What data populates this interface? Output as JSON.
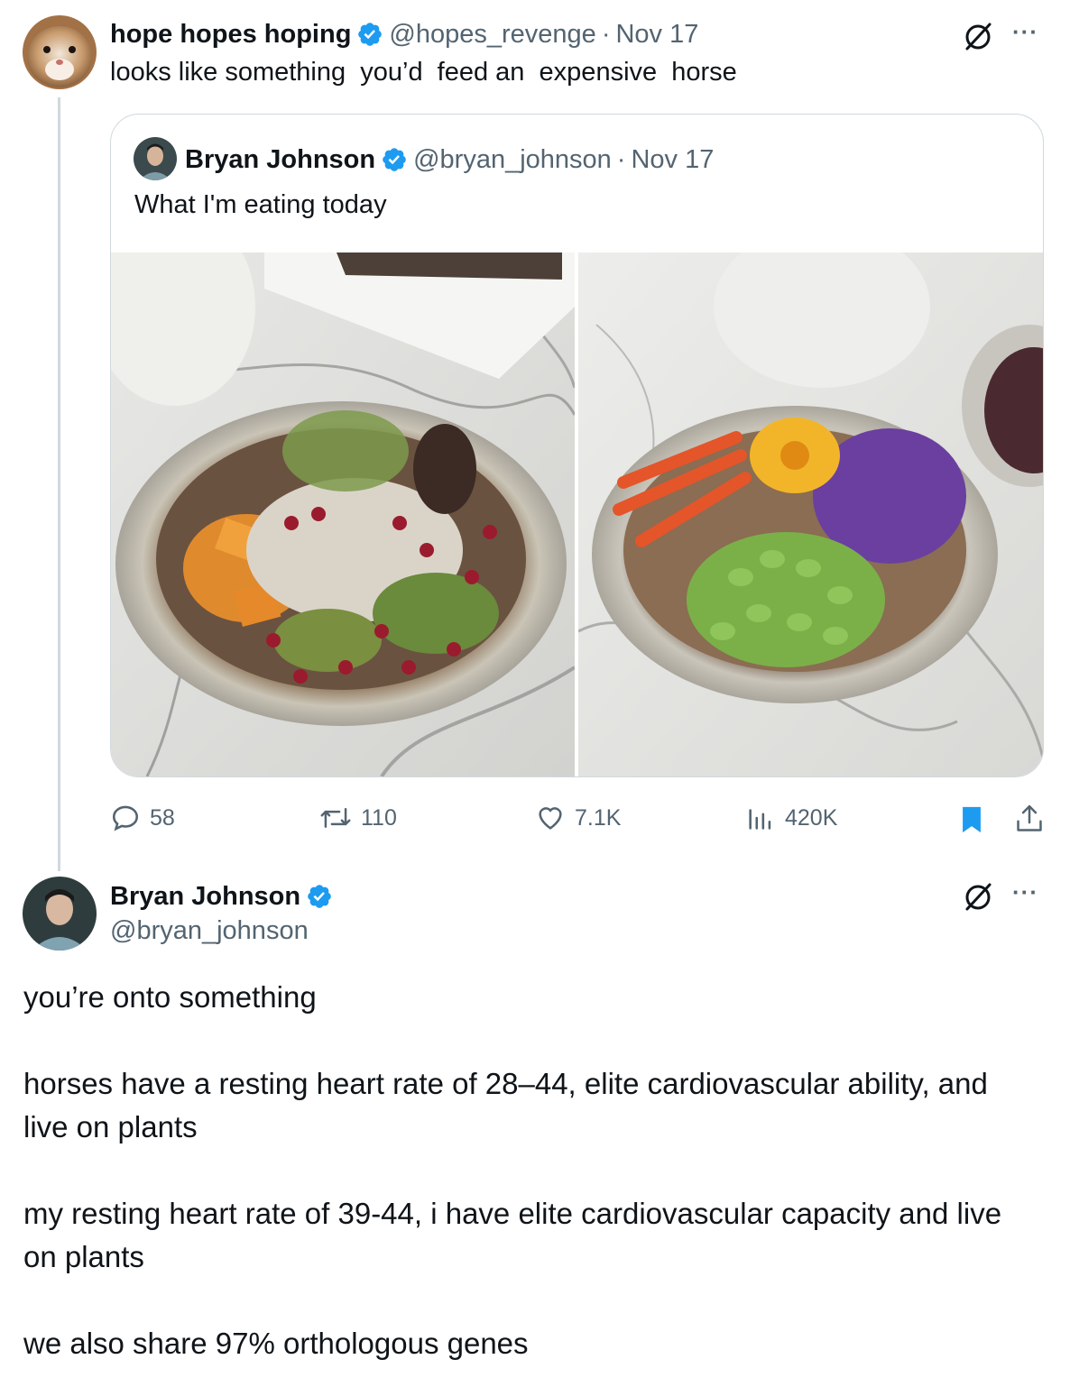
{
  "reply": {
    "display_name": "hope hopes hoping",
    "handle": "@hopes_revenge",
    "separator": "·",
    "date": "Nov 17",
    "text": "looks like something  you’d  feed an  expensive  horse",
    "avatar_icon": "hamster-avatar",
    "more_label": "···"
  },
  "quoted": {
    "display_name": "Bryan Johnson",
    "handle": "@bryan_johnson",
    "separator": "·",
    "date": "Nov 17",
    "text": "What I'm eating today",
    "images": [
      "winter-bowl-photo",
      "edamame-bowl-photo"
    ]
  },
  "actions": {
    "replies": "58",
    "reposts": "110",
    "likes": "7.1K",
    "views": "420K"
  },
  "main": {
    "display_name": "Bryan Johnson",
    "handle": "@bryan_johnson",
    "more_label": "···",
    "paragraphs": [
      "you’re onto something",
      "horses have a resting heart rate of 28–44, elite cardiovascular ability, and live on plants",
      "my resting heart rate of 39-44, i have elite cardiovascular capacity and live on plants",
      "we also share 97% orthologous genes"
    ]
  },
  "colors": {
    "verified": "#1d9bf0",
    "bookmark": "#1d9bf0",
    "text": "#0f1419",
    "muted": "#536471",
    "border": "#cfd9de"
  }
}
